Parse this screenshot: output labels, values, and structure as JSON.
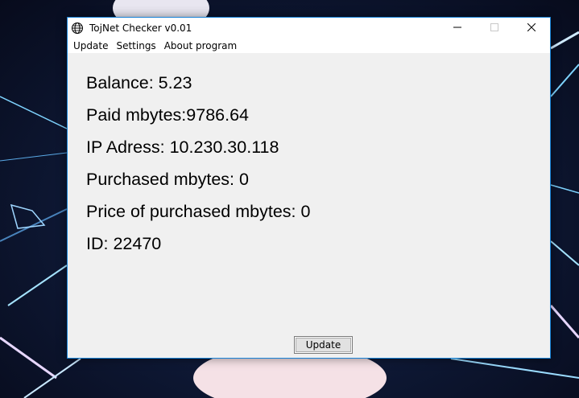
{
  "window": {
    "title": "TojNet Checker v0.01",
    "app_icon": "globe-icon",
    "controls": [
      "minimize-icon",
      "maximize-icon",
      "close-icon"
    ]
  },
  "menu": {
    "items": [
      {
        "label": "Update"
      },
      {
        "label": "Settings"
      },
      {
        "label": "About program"
      }
    ]
  },
  "info": {
    "balance": "Balance: 5.23",
    "paid_mbytes": "Paid mbytes:9786.64",
    "ip_address": "IP Adress: 10.230.30.118",
    "purchased_mbytes": "Purchased mbytes: 0",
    "price_purchased": "Price of purchased mbytes: 0",
    "id": "ID: 22470"
  },
  "buttons": {
    "update_label": "Update"
  },
  "colors": {
    "window_border": "#1883d7",
    "window_bg": "#f0f0f0",
    "titlebar_bg": "#ffffff"
  }
}
